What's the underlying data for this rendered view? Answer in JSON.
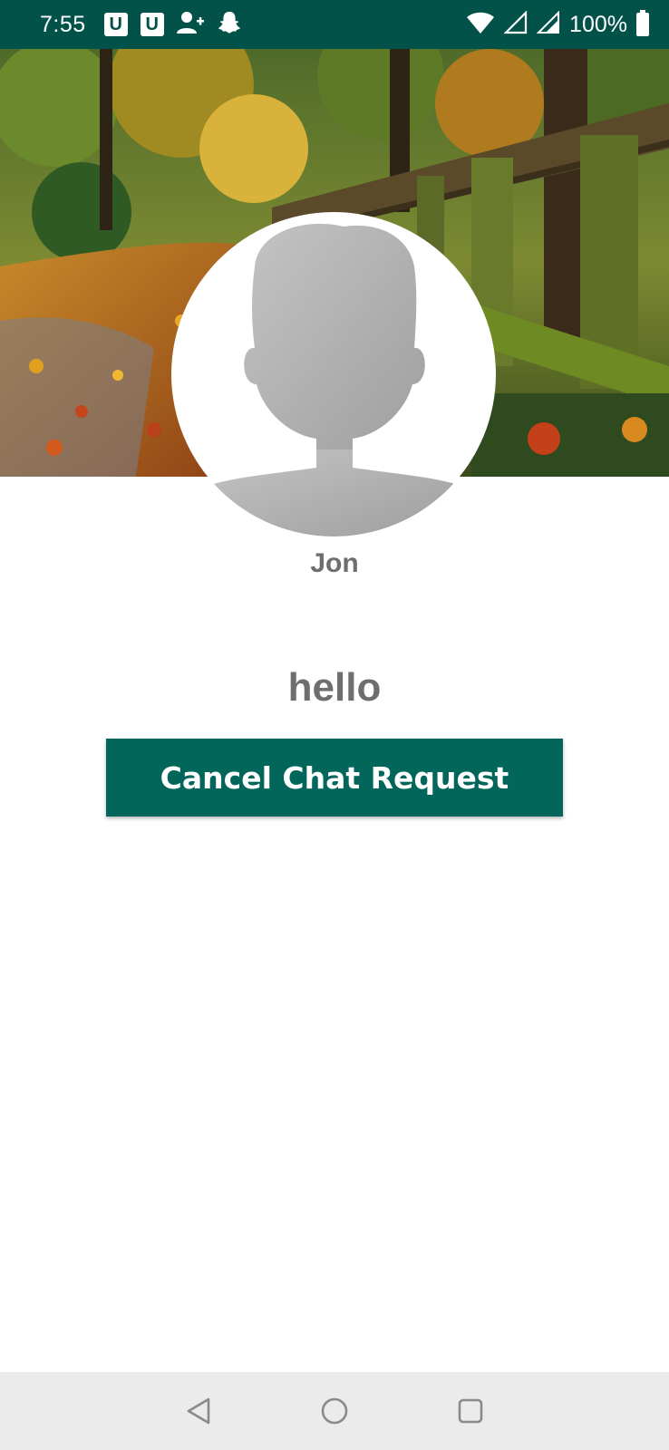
{
  "status_bar": {
    "time": "7:55",
    "notification_icons": [
      "u-app-icon",
      "u-app-icon",
      "add-contact-icon",
      "snapchat-icon"
    ],
    "u_badge_text": "U",
    "battery": "100%",
    "signal_icons": [
      "wifi-icon",
      "cell-signal-icon",
      "cell-signal-icon"
    ],
    "background": "#02524a"
  },
  "profile": {
    "name": "Jon",
    "status": "hello"
  },
  "actions": {
    "cancel_label": "Cancel Chat Request",
    "button_color": "#02665a"
  },
  "nav_bar": {
    "buttons": [
      "back-icon",
      "home-icon",
      "recents-icon"
    ]
  }
}
